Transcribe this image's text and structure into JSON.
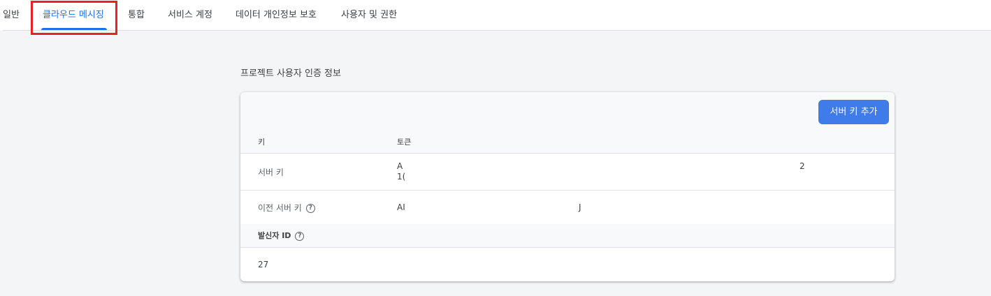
{
  "tabs": [
    {
      "label": "일반"
    },
    {
      "label": "클라우드 메시징"
    },
    {
      "label": "통합"
    },
    {
      "label": "서비스 계정"
    },
    {
      "label": "데이터 개인정보 보호"
    },
    {
      "label": "사용자 및 권한"
    }
  ],
  "section": {
    "title": "프로젝트 사용자 인증 정보"
  },
  "card": {
    "add_button_label": "서버 키 추가",
    "columns": {
      "key": "키",
      "token": "토큰"
    },
    "rows": [
      {
        "label": "서버 키",
        "token_line1": "A",
        "token_line2": "1(",
        "token_trail": "2"
      },
      {
        "label": "이전 서버 키",
        "token": "AI",
        "token_trail": "J"
      }
    ],
    "sender": {
      "label": "발신자 ID",
      "value": "27"
    }
  },
  "colors": {
    "accent": "#1a73e8",
    "button": "#3f7ce9",
    "highlight": "#e8231f"
  },
  "icons": {
    "help": "help-circle-icon"
  }
}
